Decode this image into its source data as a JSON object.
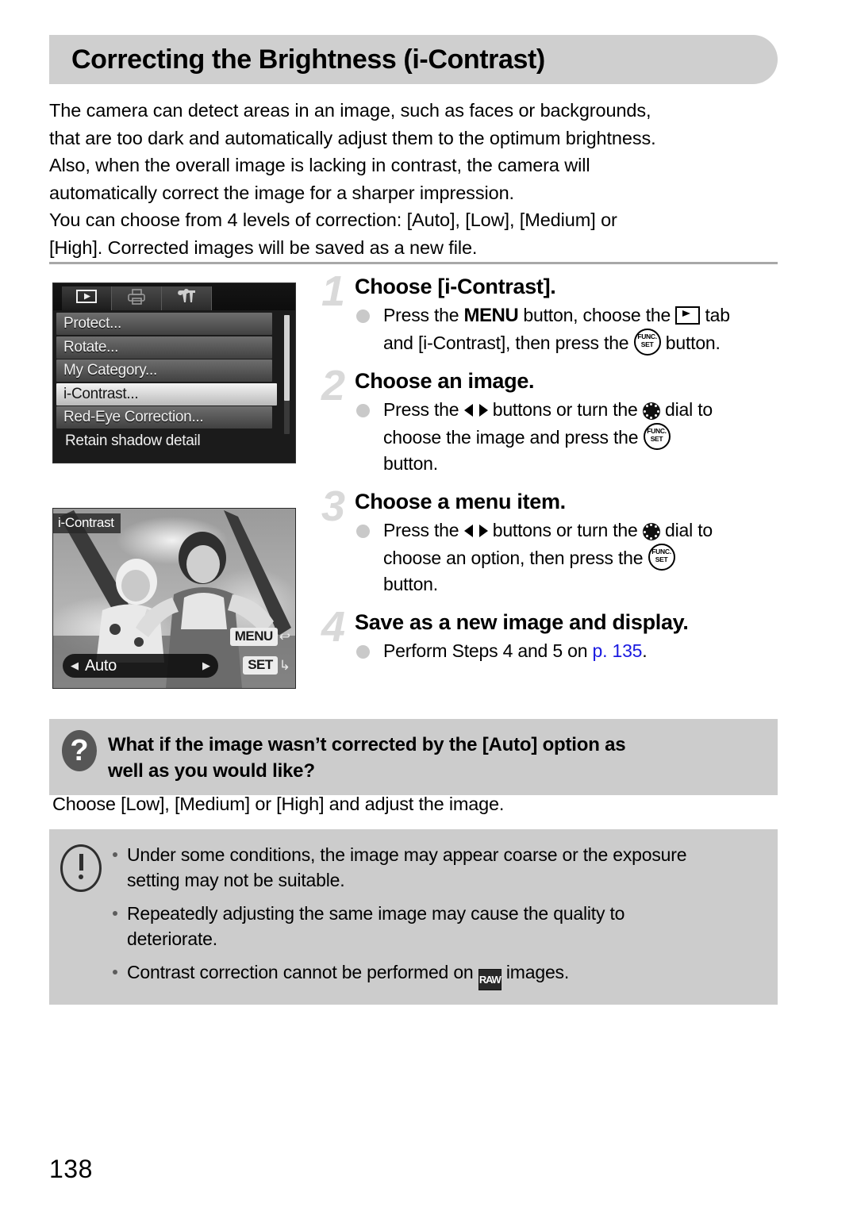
{
  "page": {
    "title": "Correcting the Brightness (i-Contrast)",
    "number": "138"
  },
  "intro": {
    "line1": "The camera can detect areas in an image, such as faces or backgrounds,",
    "line2": "that are too dark and automatically adjust them to the optimum brightness.",
    "line3": "Also, when the overall image is lacking in contrast, the camera will",
    "line4": "automatically correct the image for a sharper impression.",
    "line5": "You can choose from 4 levels of correction: [Auto], [Low], [Medium] or",
    "line6": "[High]. Corrected images will be saved as a new file."
  },
  "camera_menu_screen": {
    "tabs": [
      {
        "name": "playback-tab",
        "icon": "play-icon",
        "active": true
      },
      {
        "name": "print-tab",
        "icon": "printer-icon",
        "active": false
      },
      {
        "name": "settings-tab",
        "icon": "wrench-hammer-icon",
        "active": false
      }
    ],
    "items": [
      {
        "label": "Protect...",
        "selected": false
      },
      {
        "label": "Rotate...",
        "selected": false
      },
      {
        "label": "My Category...",
        "selected": false
      },
      {
        "label": "i-Contrast...",
        "selected": true
      },
      {
        "label": "Red-Eye Correction...",
        "selected": false
      }
    ],
    "footer_item": "Retain shadow detail"
  },
  "camera_photo_screen": {
    "badge": "i-Contrast",
    "option_value": "Auto",
    "left_arrow": "◀",
    "right_arrow": "▶",
    "hint_menu_label": "MENU",
    "hint_menu_glyph": "↩",
    "hint_set_label": "SET",
    "hint_set_glyph": "↳"
  },
  "steps": [
    {
      "number": "1",
      "heading": "Choose [i-Contrast].",
      "bullet_parts": {
        "p1": "Press the ",
        "menu_icon_label": "MENU",
        "p2": " button, choose the ",
        "p3": " tab",
        "p4": "and [i-Contrast], then press the ",
        "p5": " button."
      }
    },
    {
      "number": "2",
      "heading": "Choose an image.",
      "bullet_parts": {
        "p1": "Press the ",
        "p2": " buttons or turn the ",
        "p3": " dial to",
        "p4": "choose the image and press the ",
        "p5": "button."
      }
    },
    {
      "number": "3",
      "heading": "Choose a menu item.",
      "bullet_parts": {
        "p1": "Press the ",
        "p2": " buttons or turn the ",
        "p3": " dial to",
        "p4": "choose an option, then press the ",
        "p5": "button."
      }
    },
    {
      "number": "4",
      "heading": "Save as a new image and display.",
      "bullet_parts": {
        "p1": "Perform Steps 4 and 5 on ",
        "link": "p. 135",
        "p2": "."
      }
    }
  ],
  "tip": {
    "icon": "question-mark-icon",
    "title_line1": "What if the image wasn’t corrected by the [Auto] option as",
    "title_line2": "well as you would like?",
    "answer": "Choose [Low], [Medium] or [High] and adjust the image."
  },
  "caution": {
    "icon": "exclamation-icon",
    "items": [
      {
        "text_line1": "Under some conditions, the image may appear coarse or the exposure",
        "text_line2": "setting may not be suitable."
      },
      {
        "text_line1": "Repeatedly adjusting the same image may cause the quality to",
        "text_line2": "deteriorate."
      },
      {
        "text_line1": "Contrast correction cannot be performed on ",
        "raw_label": "RAW",
        "text_line2": " images."
      }
    ]
  },
  "colors": {
    "banner_gray": "#cfcfcf",
    "box_gray": "#cccccc",
    "link_blue": "#1a1ae0",
    "step_number_gray": "#d9d9d9"
  }
}
